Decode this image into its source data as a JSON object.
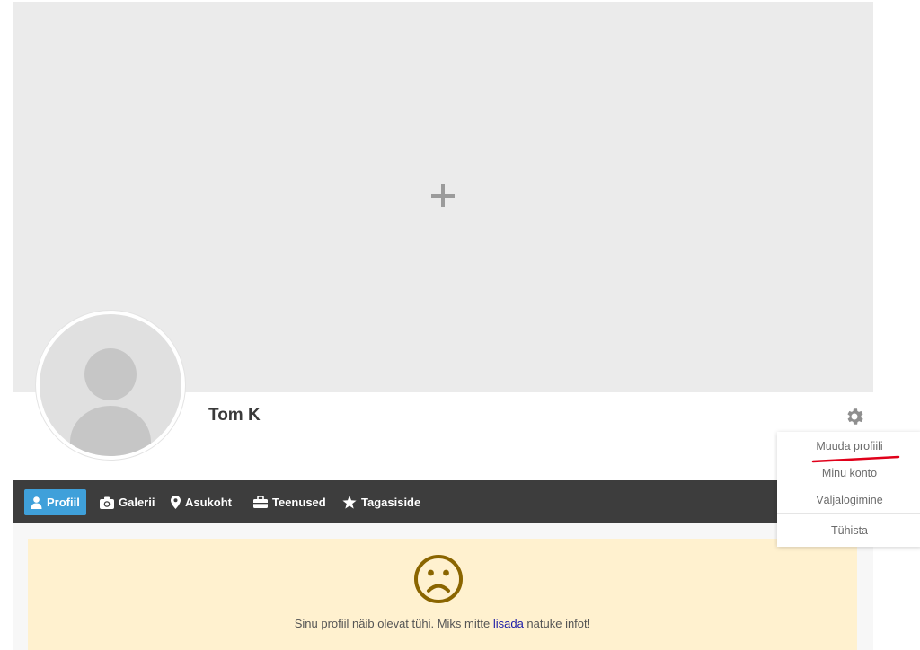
{
  "profile": {
    "name": "Tom K"
  },
  "cover": {
    "add_icon": "plus-icon"
  },
  "nav": {
    "items": [
      {
        "label": "Profiil",
        "icon": "user-icon",
        "active": true
      },
      {
        "label": "Galerii",
        "icon": "camera-icon",
        "active": false
      },
      {
        "label": "Asukoht",
        "icon": "map-pin-icon",
        "active": false
      },
      {
        "label": "Teenused",
        "icon": "briefcase-icon",
        "active": false
      },
      {
        "label": "Tagasiside",
        "icon": "star-icon",
        "active": false
      }
    ]
  },
  "settings_menu": {
    "icon": "gear-icon",
    "items": [
      {
        "label": "Muuda profiili"
      },
      {
        "label": "Minu konto"
      },
      {
        "label": "Väljalogimine"
      },
      {
        "label": "Tühista"
      }
    ]
  },
  "notice": {
    "icon": "sad-face-icon",
    "text_before": "Sinu profiil näib olevat tühi. Miks mitte ",
    "link": "lisada",
    "text_after": " natuke infot!"
  },
  "colors": {
    "nav_bg": "#3d3d3d",
    "active_tab": "#3fa0da",
    "notice_bg": "#fff1cf",
    "sad_icon": "#8a6500",
    "annotation": "#e0001a"
  }
}
